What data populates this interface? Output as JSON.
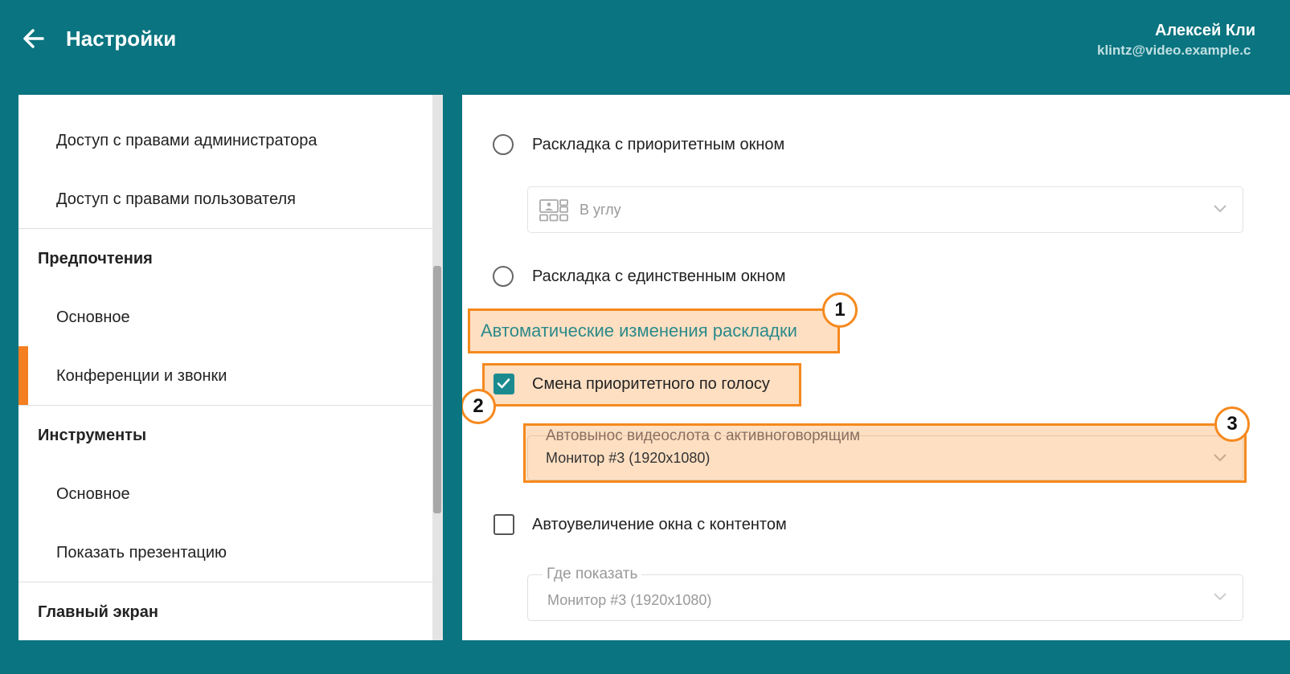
{
  "header": {
    "title": "Настройки",
    "user_name": "Алексей Кли",
    "user_email": "klintz@video.example.c"
  },
  "sidebar": {
    "items": [
      {
        "label": "Доступ с правами администратора",
        "type": "item"
      },
      {
        "label": "Доступ с правами пользователя",
        "type": "item"
      },
      {
        "label": "Предпочтения",
        "type": "section"
      },
      {
        "label": "Основное",
        "type": "item"
      },
      {
        "label": "Конференции и звонки",
        "type": "item",
        "active": true
      },
      {
        "label": "Инструменты",
        "type": "section"
      },
      {
        "label": "Основное",
        "type": "item"
      },
      {
        "label": "Показать презентацию",
        "type": "item"
      },
      {
        "label": "Главный экран",
        "type": "section"
      }
    ]
  },
  "content": {
    "layout_priority": {
      "label": "Раскладка с приоритетным окном",
      "selected": false,
      "select_value": "В углу"
    },
    "layout_single": {
      "label": "Раскладка с единственным окном",
      "selected": false
    },
    "auto_section_heading": "Автоматические изменения раскладки",
    "voice_switch": {
      "label": "Смена приоритетного по голосу",
      "checked": true
    },
    "auto_move_select": {
      "label": "Автовынос видеослота с активноговорящим",
      "value": "Монитор #3 (1920x1080)"
    },
    "auto_zoom": {
      "label": "Автоувеличение окна с контентом",
      "checked": false
    },
    "where_select": {
      "label": "Где показать",
      "value": "Монитор #3 (1920x1080)"
    }
  },
  "annotations": {
    "badge1": "1",
    "badge2": "2",
    "badge3": "3"
  },
  "colors": {
    "header_bg": "#0a7480",
    "accent_orange": "#f47f20",
    "heading_teal": "#2c8a8a",
    "checkbox_teal": "#1a8a8f"
  }
}
